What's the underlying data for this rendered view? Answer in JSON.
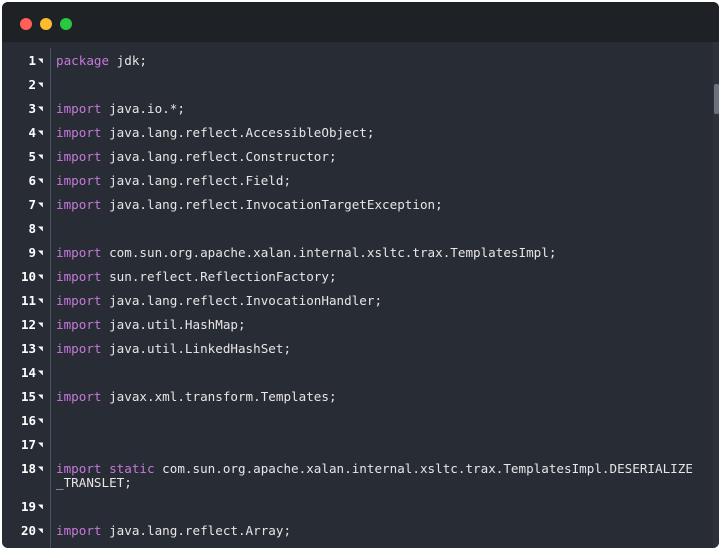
{
  "colors": {
    "background": "#282c34",
    "titlebar": "#1e2125",
    "keyword": "#c678dd",
    "text": "#e6e6e6",
    "close": "#ff5f57",
    "minimize": "#febc2e",
    "maximize": "#28c840"
  },
  "lines": [
    {
      "n": "1",
      "kw": "package",
      "rest": " jdk;"
    },
    {
      "n": "2",
      "kw": "",
      "rest": ""
    },
    {
      "n": "3",
      "kw": "import",
      "rest": " java.io.*;"
    },
    {
      "n": "4",
      "kw": "import",
      "rest": " java.lang.reflect.AccessibleObject;"
    },
    {
      "n": "5",
      "kw": "import",
      "rest": " java.lang.reflect.Constructor;"
    },
    {
      "n": "6",
      "kw": "import",
      "rest": " java.lang.reflect.Field;"
    },
    {
      "n": "7",
      "kw": "import",
      "rest": " java.lang.reflect.InvocationTargetException;"
    },
    {
      "n": "8",
      "kw": "",
      "rest": ""
    },
    {
      "n": "9",
      "kw": "import",
      "rest": " com.sun.org.apache.xalan.internal.xsltc.trax.TemplatesImpl;"
    },
    {
      "n": "10",
      "kw": "import",
      "rest": " sun.reflect.ReflectionFactory;"
    },
    {
      "n": "11",
      "kw": "import",
      "rest": " java.lang.reflect.InvocationHandler;"
    },
    {
      "n": "12",
      "kw": "import",
      "rest": " java.util.HashMap;"
    },
    {
      "n": "13",
      "kw": "import",
      "rest": " java.util.LinkedHashSet;"
    },
    {
      "n": "14",
      "kw": "",
      "rest": ""
    },
    {
      "n": "15",
      "kw": "import",
      "rest": " javax.xml.transform.Templates;"
    },
    {
      "n": "16",
      "kw": "",
      "rest": ""
    },
    {
      "n": "17",
      "kw": "",
      "rest": ""
    },
    {
      "n": "18",
      "kw": "import static",
      "rest": " com.sun.org.apache.xalan.internal.xsltc.trax.TemplatesImpl.DESERIALIZE\n_TRANSLET;"
    },
    {
      "n": "19",
      "kw": "",
      "rest": ""
    },
    {
      "n": "20",
      "kw": "import",
      "rest": " java.lang.reflect.Array;"
    }
  ]
}
